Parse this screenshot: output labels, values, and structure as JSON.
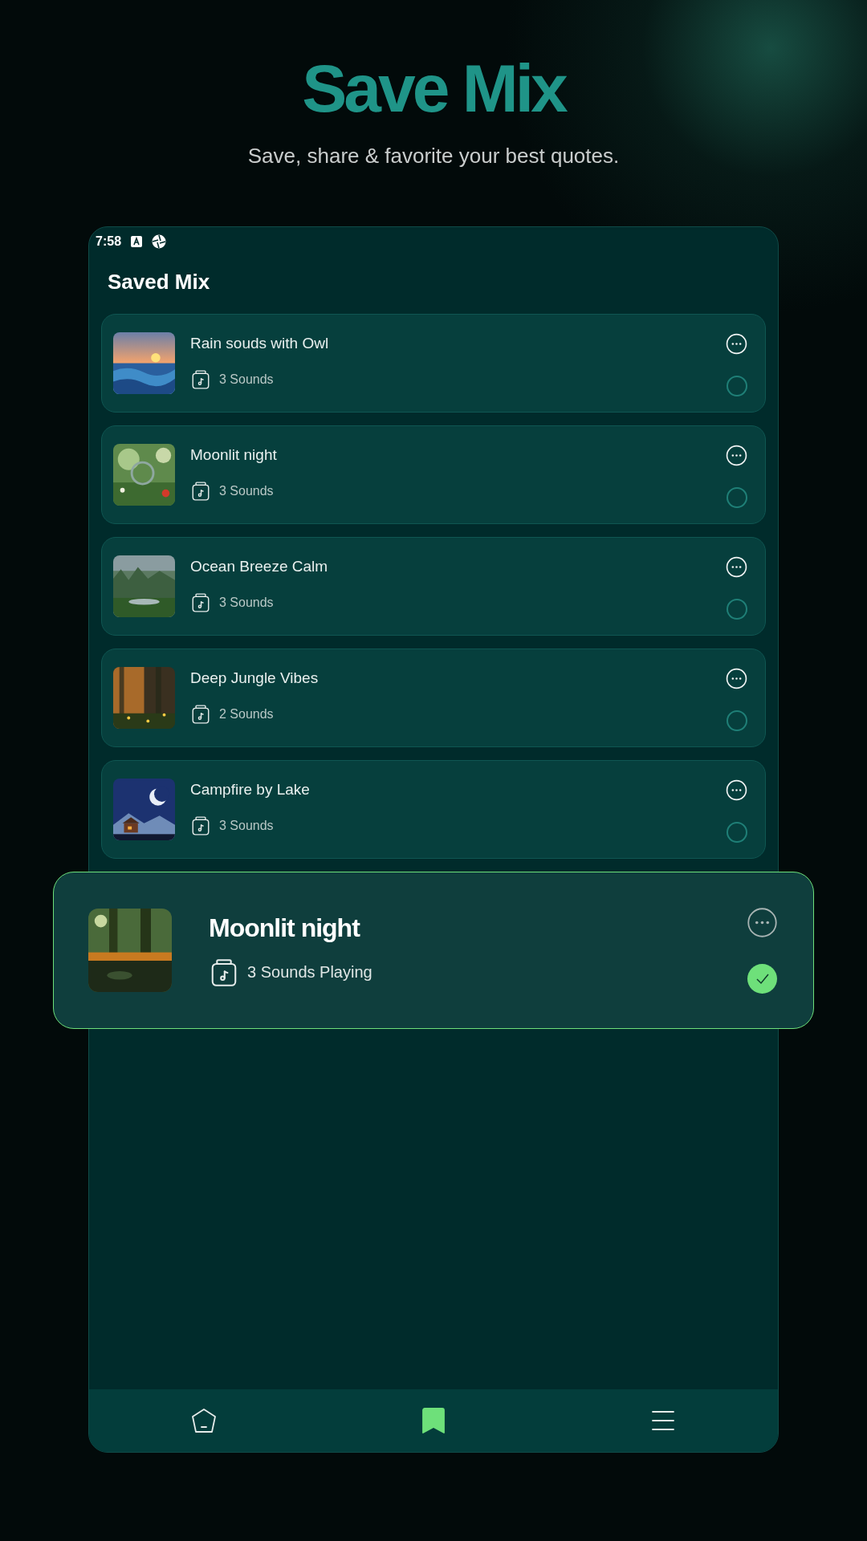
{
  "header": {
    "title": "Save Mix",
    "subtitle": "Save, share & favorite your best quotes."
  },
  "status_bar": {
    "time": "7:58"
  },
  "screen_title": "Saved Mix",
  "mixes": [
    {
      "title": "Rain souds with Owl",
      "sounds": "3 Sounds",
      "selected": false
    },
    {
      "title": "Moonlit night",
      "sounds": "3 Sounds",
      "selected": false
    },
    {
      "title": "Ocean Breeze Calm",
      "sounds": "3 Sounds",
      "selected": false
    },
    {
      "title": "Deep Jungle Vibes",
      "sounds": "2 Sounds",
      "selected": false
    },
    {
      "title": "Campfire by Lake",
      "sounds": "3 Sounds",
      "selected": false
    }
  ],
  "now_playing": {
    "title": "Moonlit night",
    "status": "3 Sounds Playing",
    "checked": true
  },
  "nav": [
    {
      "kind": "home",
      "selected": false
    },
    {
      "kind": "saved",
      "selected": true
    },
    {
      "kind": "menu",
      "selected": false
    }
  ]
}
